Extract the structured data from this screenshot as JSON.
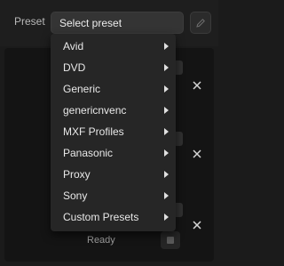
{
  "preset": {
    "label": "Preset",
    "select_value": "Select preset"
  },
  "menu": {
    "items": [
      {
        "label": "Avid"
      },
      {
        "label": "DVD"
      },
      {
        "label": "Generic"
      },
      {
        "label": "genericnvenc"
      },
      {
        "label": "MXF Profiles"
      },
      {
        "label": "Panasonic"
      },
      {
        "label": "Proxy"
      },
      {
        "label": "Sony"
      },
      {
        "label": "Custom Presets"
      }
    ]
  },
  "status": {
    "ready_text": "Ready"
  },
  "icons": {
    "edit": "pencil-icon",
    "close": "close-icon",
    "submenu": "chevron-right-icon",
    "stop": "stop-icon"
  },
  "colors": {
    "background": "#1b1b1b",
    "menu_background": "#262626",
    "select_background": "#343434",
    "text": "#e8e8e8"
  }
}
